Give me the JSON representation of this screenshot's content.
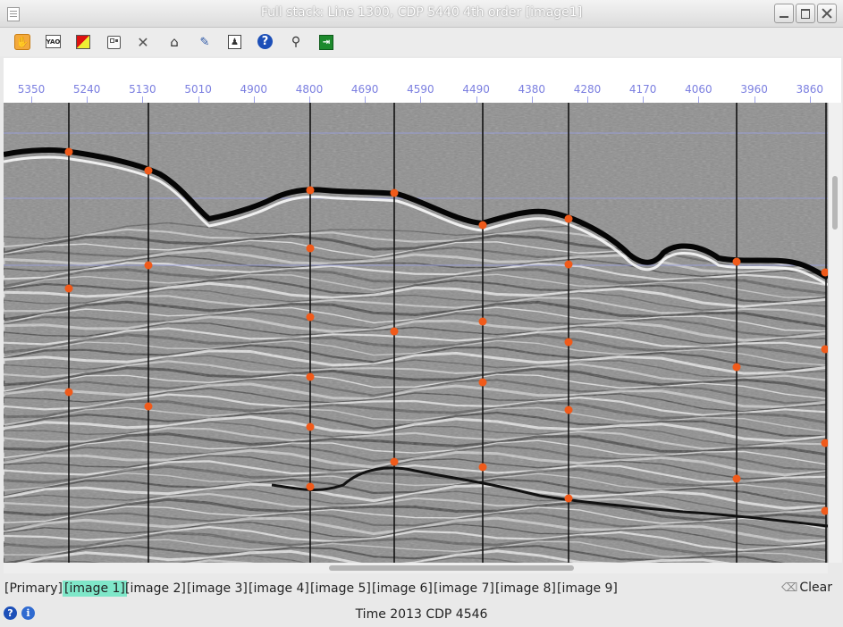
{
  "window": {
    "title": "Full stack: Line 1300, CDP 5440 4th order [image1]"
  },
  "toolbar": {
    "tools": [
      {
        "name": "pan-hand-icon"
      },
      {
        "name": "label-toggle-icon",
        "text": "YAO"
      },
      {
        "name": "pick-color-icon"
      },
      {
        "name": "grid-view-icon"
      },
      {
        "name": "close-icon",
        "glyph": "✕"
      },
      {
        "name": "home-icon",
        "glyph": "⌂"
      },
      {
        "name": "edit-icon",
        "glyph": "✎"
      },
      {
        "name": "person-icon",
        "glyph": "♟"
      },
      {
        "name": "help-icon",
        "glyph": "?"
      },
      {
        "name": "zoom-icon",
        "glyph": "⚲"
      },
      {
        "name": "exit-icon",
        "glyph": "⇥"
      }
    ]
  },
  "axis": {
    "cdp_ticks": [
      "5350",
      "5240",
      "5130",
      "5010",
      "4900",
      "4800",
      "4690",
      "4590",
      "4490",
      "4380",
      "4280",
      "4170",
      "4060",
      "3960",
      "3860"
    ],
    "color": "#7b7fe0"
  },
  "seismic": {
    "pick_color": "#f05a1a",
    "horizon_color": "#9aa0e6",
    "background": "#8d8d8d"
  },
  "tabs": [
    {
      "label": "[Primary]",
      "active": false
    },
    {
      "label": "[image 1]",
      "active": true
    },
    {
      "label": "[image 2]",
      "active": false
    },
    {
      "label": "[image 3]",
      "active": false
    },
    {
      "label": "[image 4]",
      "active": false
    },
    {
      "label": "[image 5]",
      "active": false
    },
    {
      "label": "[image 6]",
      "active": false
    },
    {
      "label": "[image 7]",
      "active": false
    },
    {
      "label": "[image 8]",
      "active": false
    },
    {
      "label": "[image 9]",
      "active": false
    }
  ],
  "clear_label": "Clear",
  "status": {
    "text": "Time 2013 CDP  4546"
  }
}
